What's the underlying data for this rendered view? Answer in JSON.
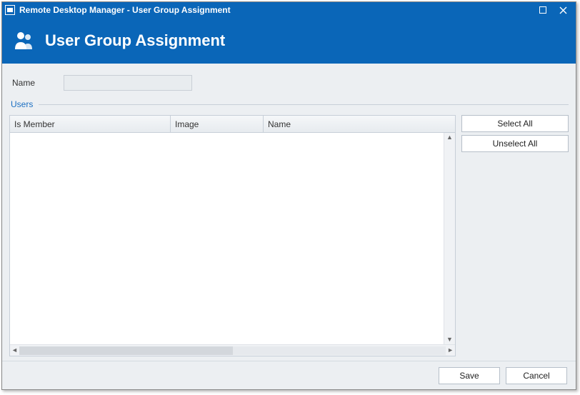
{
  "window": {
    "title": "Remote Desktop Manager - User Group Assignment"
  },
  "header": {
    "title": "User Group Assignment"
  },
  "form": {
    "name_label": "Name",
    "name_value": ""
  },
  "users_section": {
    "legend": "Users",
    "columns": {
      "is_member": "Is Member",
      "image": "Image",
      "name": "Name"
    },
    "rows": []
  },
  "side": {
    "select_all": "Select All",
    "unselect_all": "Unselect All"
  },
  "footer": {
    "save": "Save",
    "cancel": "Cancel"
  }
}
